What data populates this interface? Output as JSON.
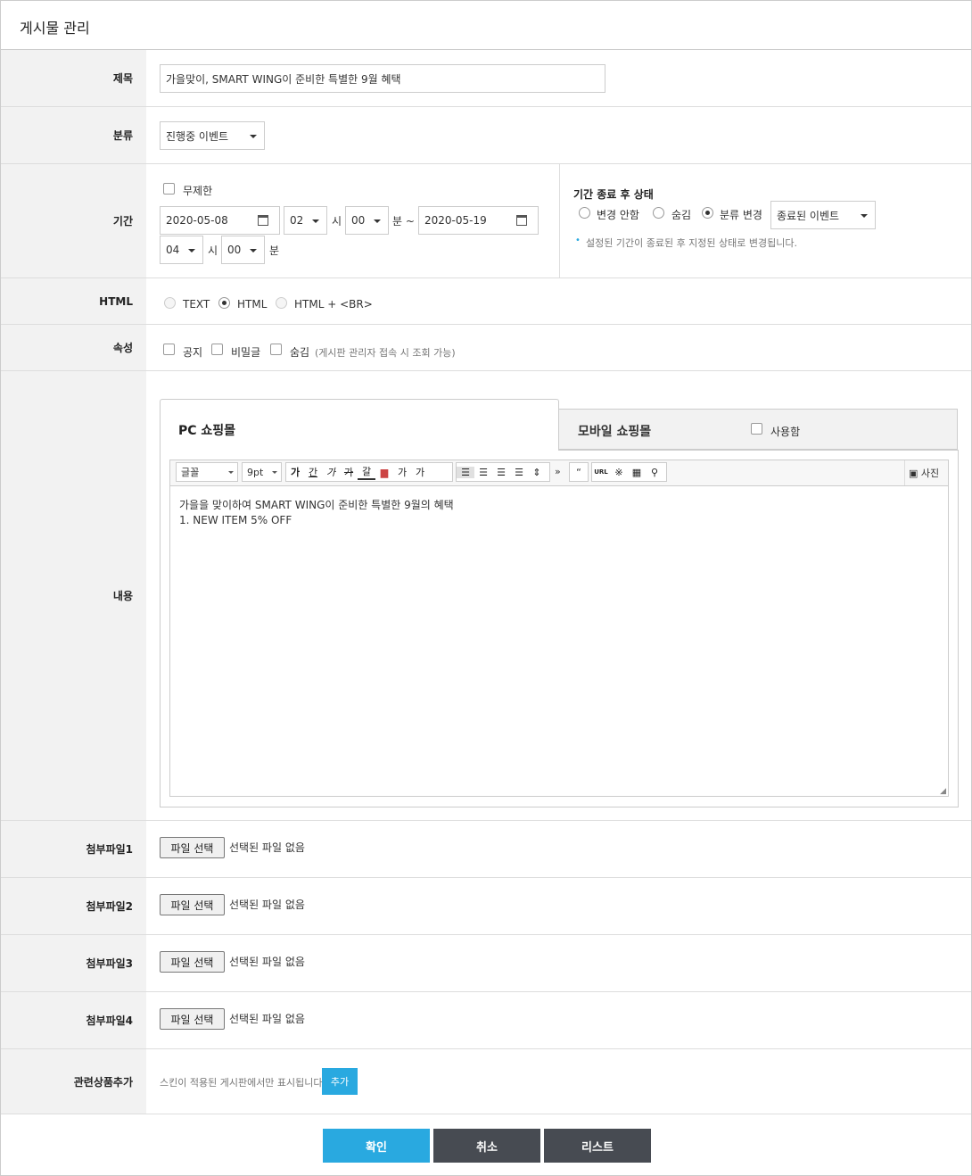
{
  "title": "게시물 관리",
  "rows": {
    "subject": {
      "label": "제목",
      "value": "가을맞이, SMART WING이 준비한 특별한 9월 혜택"
    },
    "category": {
      "label": "분류",
      "value": "진행중 이벤트"
    },
    "period": {
      "label": "기간",
      "unlimited": "무제한",
      "start_date": "2020-05-08",
      "start_hour": "02",
      "hour_unit": "시",
      "start_min": "00",
      "min_unit": "분 ~",
      "end_date": "2020-05-19",
      "end_hour": "04",
      "end_min": "00",
      "min_unit_end": "분",
      "after_title": "기간 종료 후 상태",
      "opt_nochange": "변경 안함",
      "opt_hide": "숨김",
      "opt_change": "분류 변경",
      "change_target": "종료된 이벤트",
      "note_bullet": "•",
      "note": "설정된 기간이 종료된 후 지정된 상태로 변경됩니다."
    },
    "html": {
      "label": "HTML",
      "opt_text": "TEXT",
      "opt_html": "HTML",
      "opt_br": "HTML + <BR>"
    },
    "attr": {
      "label": "속성",
      "notice": "공지",
      "secret": "비밀글",
      "hide": "숨김",
      "hide_note": "(게시판 관리자 접속 시 조회 가능)"
    },
    "content": {
      "label": "내용",
      "tab_pc": "PC 쇼핑몰",
      "tab_mobile": "모바일 쇼핑몰",
      "use": "사용함",
      "font": "글꼴",
      "size": "9pt",
      "photo": "사진",
      "line1": "가을을 맞이하여 SMART WING이 준비한 특별한 9월의 혜택",
      "line2": "1. NEW ITEM 5% OFF",
      "tools": {
        "bold": "가",
        "underline": "간",
        "italic": "가",
        "strike": "가",
        "fontcolor": "갈",
        "sup": "가",
        "sub": "가",
        "quote": "“",
        "url": "URL",
        "more": "»",
        "special": "※",
        "search": "⚲"
      }
    },
    "files": [
      {
        "label": "첨부파일1",
        "btn": "파일 선택",
        "status": "선택된 파일 없음"
      },
      {
        "label": "첨부파일2",
        "btn": "파일 선택",
        "status": "선택된 파일 없음"
      },
      {
        "label": "첨부파일3",
        "btn": "파일 선택",
        "status": "선택된 파일 없음"
      },
      {
        "label": "첨부파일4",
        "btn": "파일 선택",
        "status": "선택된 파일 없음"
      }
    ],
    "related": {
      "label": "관련상품추가",
      "note": "스킨이 적용된 게시판에서만 표시됩니다.",
      "add": "추가"
    }
  },
  "buttons": {
    "confirm": "확인",
    "cancel": "취소",
    "list": "리스트"
  },
  "colors": {
    "accent": "#29a9e0",
    "dark": "#474b52",
    "label_bg": "#f2f2f2"
  }
}
